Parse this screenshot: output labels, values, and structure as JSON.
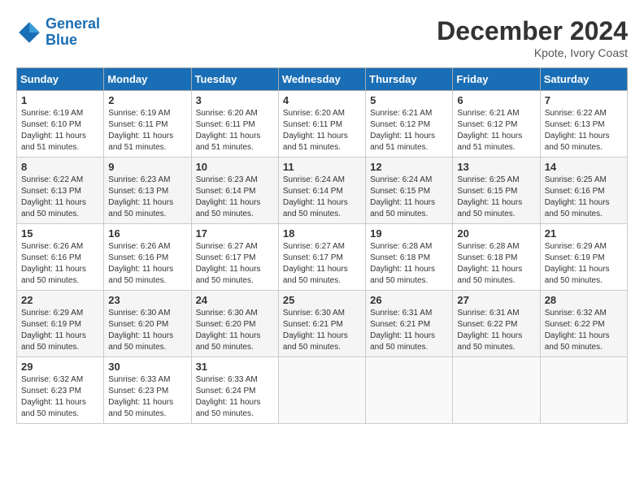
{
  "header": {
    "logo_line1": "General",
    "logo_line2": "Blue",
    "month_title": "December 2024",
    "location": "Kpote, Ivory Coast"
  },
  "weekdays": [
    "Sunday",
    "Monday",
    "Tuesday",
    "Wednesday",
    "Thursday",
    "Friday",
    "Saturday"
  ],
  "weeks": [
    [
      {
        "day": "1",
        "info": "Sunrise: 6:19 AM\nSunset: 6:10 PM\nDaylight: 11 hours\nand 51 minutes."
      },
      {
        "day": "2",
        "info": "Sunrise: 6:19 AM\nSunset: 6:11 PM\nDaylight: 11 hours\nand 51 minutes."
      },
      {
        "day": "3",
        "info": "Sunrise: 6:20 AM\nSunset: 6:11 PM\nDaylight: 11 hours\nand 51 minutes."
      },
      {
        "day": "4",
        "info": "Sunrise: 6:20 AM\nSunset: 6:11 PM\nDaylight: 11 hours\nand 51 minutes."
      },
      {
        "day": "5",
        "info": "Sunrise: 6:21 AM\nSunset: 6:12 PM\nDaylight: 11 hours\nand 51 minutes."
      },
      {
        "day": "6",
        "info": "Sunrise: 6:21 AM\nSunset: 6:12 PM\nDaylight: 11 hours\nand 51 minutes."
      },
      {
        "day": "7",
        "info": "Sunrise: 6:22 AM\nSunset: 6:13 PM\nDaylight: 11 hours\nand 50 minutes."
      }
    ],
    [
      {
        "day": "8",
        "info": "Sunrise: 6:22 AM\nSunset: 6:13 PM\nDaylight: 11 hours\nand 50 minutes."
      },
      {
        "day": "9",
        "info": "Sunrise: 6:23 AM\nSunset: 6:13 PM\nDaylight: 11 hours\nand 50 minutes."
      },
      {
        "day": "10",
        "info": "Sunrise: 6:23 AM\nSunset: 6:14 PM\nDaylight: 11 hours\nand 50 minutes."
      },
      {
        "day": "11",
        "info": "Sunrise: 6:24 AM\nSunset: 6:14 PM\nDaylight: 11 hours\nand 50 minutes."
      },
      {
        "day": "12",
        "info": "Sunrise: 6:24 AM\nSunset: 6:15 PM\nDaylight: 11 hours\nand 50 minutes."
      },
      {
        "day": "13",
        "info": "Sunrise: 6:25 AM\nSunset: 6:15 PM\nDaylight: 11 hours\nand 50 minutes."
      },
      {
        "day": "14",
        "info": "Sunrise: 6:25 AM\nSunset: 6:16 PM\nDaylight: 11 hours\nand 50 minutes."
      }
    ],
    [
      {
        "day": "15",
        "info": "Sunrise: 6:26 AM\nSunset: 6:16 PM\nDaylight: 11 hours\nand 50 minutes."
      },
      {
        "day": "16",
        "info": "Sunrise: 6:26 AM\nSunset: 6:16 PM\nDaylight: 11 hours\nand 50 minutes."
      },
      {
        "day": "17",
        "info": "Sunrise: 6:27 AM\nSunset: 6:17 PM\nDaylight: 11 hours\nand 50 minutes."
      },
      {
        "day": "18",
        "info": "Sunrise: 6:27 AM\nSunset: 6:17 PM\nDaylight: 11 hours\nand 50 minutes."
      },
      {
        "day": "19",
        "info": "Sunrise: 6:28 AM\nSunset: 6:18 PM\nDaylight: 11 hours\nand 50 minutes."
      },
      {
        "day": "20",
        "info": "Sunrise: 6:28 AM\nSunset: 6:18 PM\nDaylight: 11 hours\nand 50 minutes."
      },
      {
        "day": "21",
        "info": "Sunrise: 6:29 AM\nSunset: 6:19 PM\nDaylight: 11 hours\nand 50 minutes."
      }
    ],
    [
      {
        "day": "22",
        "info": "Sunrise: 6:29 AM\nSunset: 6:19 PM\nDaylight: 11 hours\nand 50 minutes."
      },
      {
        "day": "23",
        "info": "Sunrise: 6:30 AM\nSunset: 6:20 PM\nDaylight: 11 hours\nand 50 minutes."
      },
      {
        "day": "24",
        "info": "Sunrise: 6:30 AM\nSunset: 6:20 PM\nDaylight: 11 hours\nand 50 minutes."
      },
      {
        "day": "25",
        "info": "Sunrise: 6:30 AM\nSunset: 6:21 PM\nDaylight: 11 hours\nand 50 minutes."
      },
      {
        "day": "26",
        "info": "Sunrise: 6:31 AM\nSunset: 6:21 PM\nDaylight: 11 hours\nand 50 minutes."
      },
      {
        "day": "27",
        "info": "Sunrise: 6:31 AM\nSunset: 6:22 PM\nDaylight: 11 hours\nand 50 minutes."
      },
      {
        "day": "28",
        "info": "Sunrise: 6:32 AM\nSunset: 6:22 PM\nDaylight: 11 hours\nand 50 minutes."
      }
    ],
    [
      {
        "day": "29",
        "info": "Sunrise: 6:32 AM\nSunset: 6:23 PM\nDaylight: 11 hours\nand 50 minutes."
      },
      {
        "day": "30",
        "info": "Sunrise: 6:33 AM\nSunset: 6:23 PM\nDaylight: 11 hours\nand 50 minutes."
      },
      {
        "day": "31",
        "info": "Sunrise: 6:33 AM\nSunset: 6:24 PM\nDaylight: 11 hours\nand 50 minutes."
      },
      {
        "day": "",
        "info": ""
      },
      {
        "day": "",
        "info": ""
      },
      {
        "day": "",
        "info": ""
      },
      {
        "day": "",
        "info": ""
      }
    ]
  ]
}
